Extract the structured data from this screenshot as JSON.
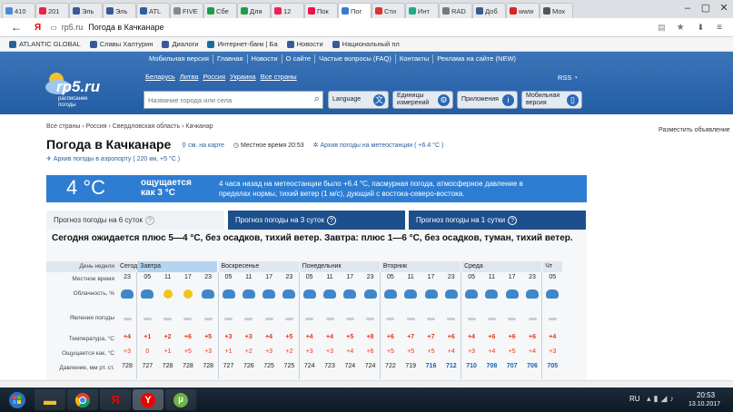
{
  "browser": {
    "tabs": [
      {
        "label": "410",
        "color": "#4a8ad4"
      },
      {
        "label": "201",
        "color": "#e24"
      },
      {
        "label": "Эль",
        "color": "#3b5998"
      },
      {
        "label": "Эль",
        "color": "#3b5998"
      },
      {
        "label": "ATL",
        "color": "#2a5fa0"
      },
      {
        "label": "FIVE",
        "color": "#888"
      },
      {
        "label": "Сбе",
        "color": "#1a9e45"
      },
      {
        "label": "Для",
        "color": "#1a9e45"
      },
      {
        "label": "12",
        "color": "#e25"
      },
      {
        "label": "Пок",
        "color": "#e14"
      },
      {
        "label": "Пог",
        "color": "#3a7bd5",
        "active": true
      },
      {
        "label": "Сти",
        "color": "#d33"
      },
      {
        "label": "Инт",
        "color": "#2a8"
      },
      {
        "label": "RAD",
        "color": "#777"
      },
      {
        "label": "Доб",
        "color": "#3b5998"
      },
      {
        "label": "www",
        "color": "#d22"
      },
      {
        "label": "Мох",
        "color": "#555"
      }
    ],
    "url_host": "rp5.ru",
    "url_title": "Погода в Качканаре",
    "bookmarks": [
      "ATLANTIC GLOBAL",
      "Славы Халтурин",
      "Диалоги",
      "Интернет-банк | Ба",
      "Новости",
      "Национальный пл"
    ]
  },
  "site": {
    "logo": "rp5.ru",
    "logo_sub": "расписание погоды",
    "topnav": [
      "Мобильная версия",
      "Главная",
      "Новости",
      "О сайте",
      "Частые вопросы (FAQ)",
      "Контакты",
      "Реклама на сайте (NEW)"
    ],
    "countries": [
      "Беларусь",
      "Литва",
      "Россия",
      "Украина",
      "Все страны"
    ],
    "rss": "RSS",
    "search_placeholder": "Название города или села",
    "buttons": {
      "language": "Language",
      "units": "Единицы измерений",
      "apps": "Приложения",
      "mobile": "Мобильная версия"
    }
  },
  "page": {
    "breadcrumb": "Все страны › Россия › Свердловская область › Качканар",
    "ad_link": "Разместить объявление",
    "title": "Погода в Качканаре",
    "map_link": "см. на карте",
    "local_time": "Местное время  20:53",
    "archive_station": "Архив погоды на метеостанции ( +6.4 °C )",
    "archive_airport": "Архив погоды в аэропорту ( 220 км, +5 °C )"
  },
  "current": {
    "temp": "4 °C",
    "feels_label": "ощущается",
    "feels_value": "как 3 °C",
    "desc": "4 часа назад на метеостанции было +6.4 °C, пасмурная погода, атмосферное давление в пределах нормы, тихий ветер (1 м/с), дующий с востока-северо-востока."
  },
  "forecast": {
    "tabs": [
      "Прогноз погоды на 6 суток",
      "Прогноз погоды на 3 суток",
      "Прогноз погоды на 1 сутки"
    ],
    "summary": "Сегодня ожидается плюс 5—4 °C, без осадков, тихий ветер. Завтра: плюс 1—6 °C, без осадков, туман, тихий ветер.",
    "labels": {
      "day": "День недели",
      "time": "Местное время",
      "clouds": "Облачность, %",
      "phen": "Явления погоды",
      "temp": "Температура, °C",
      "feels": "Ощущается как, °C",
      "press": "Давление, мм рт. ст."
    },
    "days": [
      "Сегодня",
      "Завтра",
      "Воскресенье",
      "Понедельник",
      "Вторник",
      "Среда",
      "Чт"
    ],
    "times": [
      "23",
      "05",
      "11",
      "17",
      "23",
      "05",
      "11",
      "17",
      "23",
      "05",
      "11",
      "17",
      "23",
      "05",
      "11",
      "17",
      "23",
      "05",
      "11",
      "17",
      "23",
      "05"
    ],
    "temps": [
      "+4",
      "+1",
      "+2",
      "+6",
      "+5",
      "+3",
      "+3",
      "+4",
      "+5",
      "+4",
      "+4",
      "+5",
      "+8",
      "+6",
      "+7",
      "+7",
      "+6",
      "+4",
      "+6",
      "+6",
      "+6",
      "+4"
    ],
    "feels": [
      "+3",
      "0",
      "+1",
      "+5",
      "+3",
      "+1",
      "+2",
      "+3",
      "+2",
      "+3",
      "+3",
      "+4",
      "+6",
      "+5",
      "+5",
      "+5",
      "+4",
      "+3",
      "+4",
      "+5",
      "+4",
      "+3"
    ],
    "press": [
      "728",
      "727",
      "728",
      "728",
      "728",
      "727",
      "726",
      "725",
      "725",
      "724",
      "723",
      "724",
      "724",
      "722",
      "719",
      "716",
      "712",
      "710",
      "708",
      "707",
      "706",
      "705"
    ]
  },
  "taskbar": {
    "lang": "RU",
    "time": "20:53",
    "date": "13.10.2017"
  }
}
